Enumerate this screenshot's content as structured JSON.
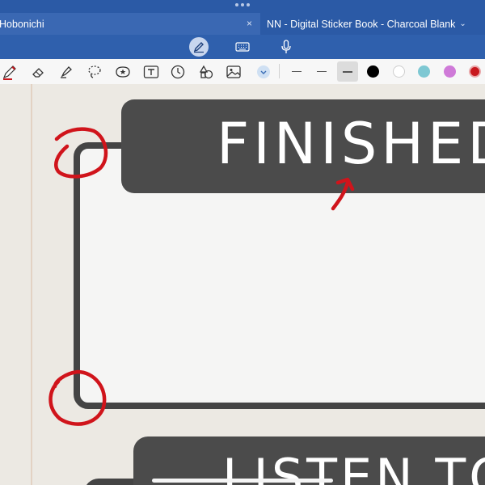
{
  "window": {
    "more_indicator": "•••"
  },
  "tabs": [
    {
      "label": "Hobonichi",
      "close": "×"
    },
    {
      "label": "NN - Digital Sticker Book - Charcoal Blank",
      "chevron": "⌄"
    }
  ],
  "input_modes": [
    "pen-icon",
    "keyboard-icon",
    "microphone-icon"
  ],
  "toolbar": {
    "tools": [
      "pen-icon",
      "eraser-icon",
      "highlighter-icon",
      "lasso-icon",
      "sticker-icon",
      "text-box-icon",
      "clock-icon",
      "shapes-icon",
      "image-icon",
      "chevron-down-icon"
    ],
    "line_widths": [
      "thin",
      "medium",
      "thick"
    ],
    "selected_line_width": "thick",
    "colors": [
      "#000000",
      "#ffffff",
      "#7ec8d3",
      "#cf7ad8",
      "#c8181e"
    ],
    "selected_color": "#c8181e"
  },
  "page": {
    "sticker_title": "FINISHED",
    "sticker2_title": "LISTEN TO"
  },
  "annotation_color": "#d0141b"
}
